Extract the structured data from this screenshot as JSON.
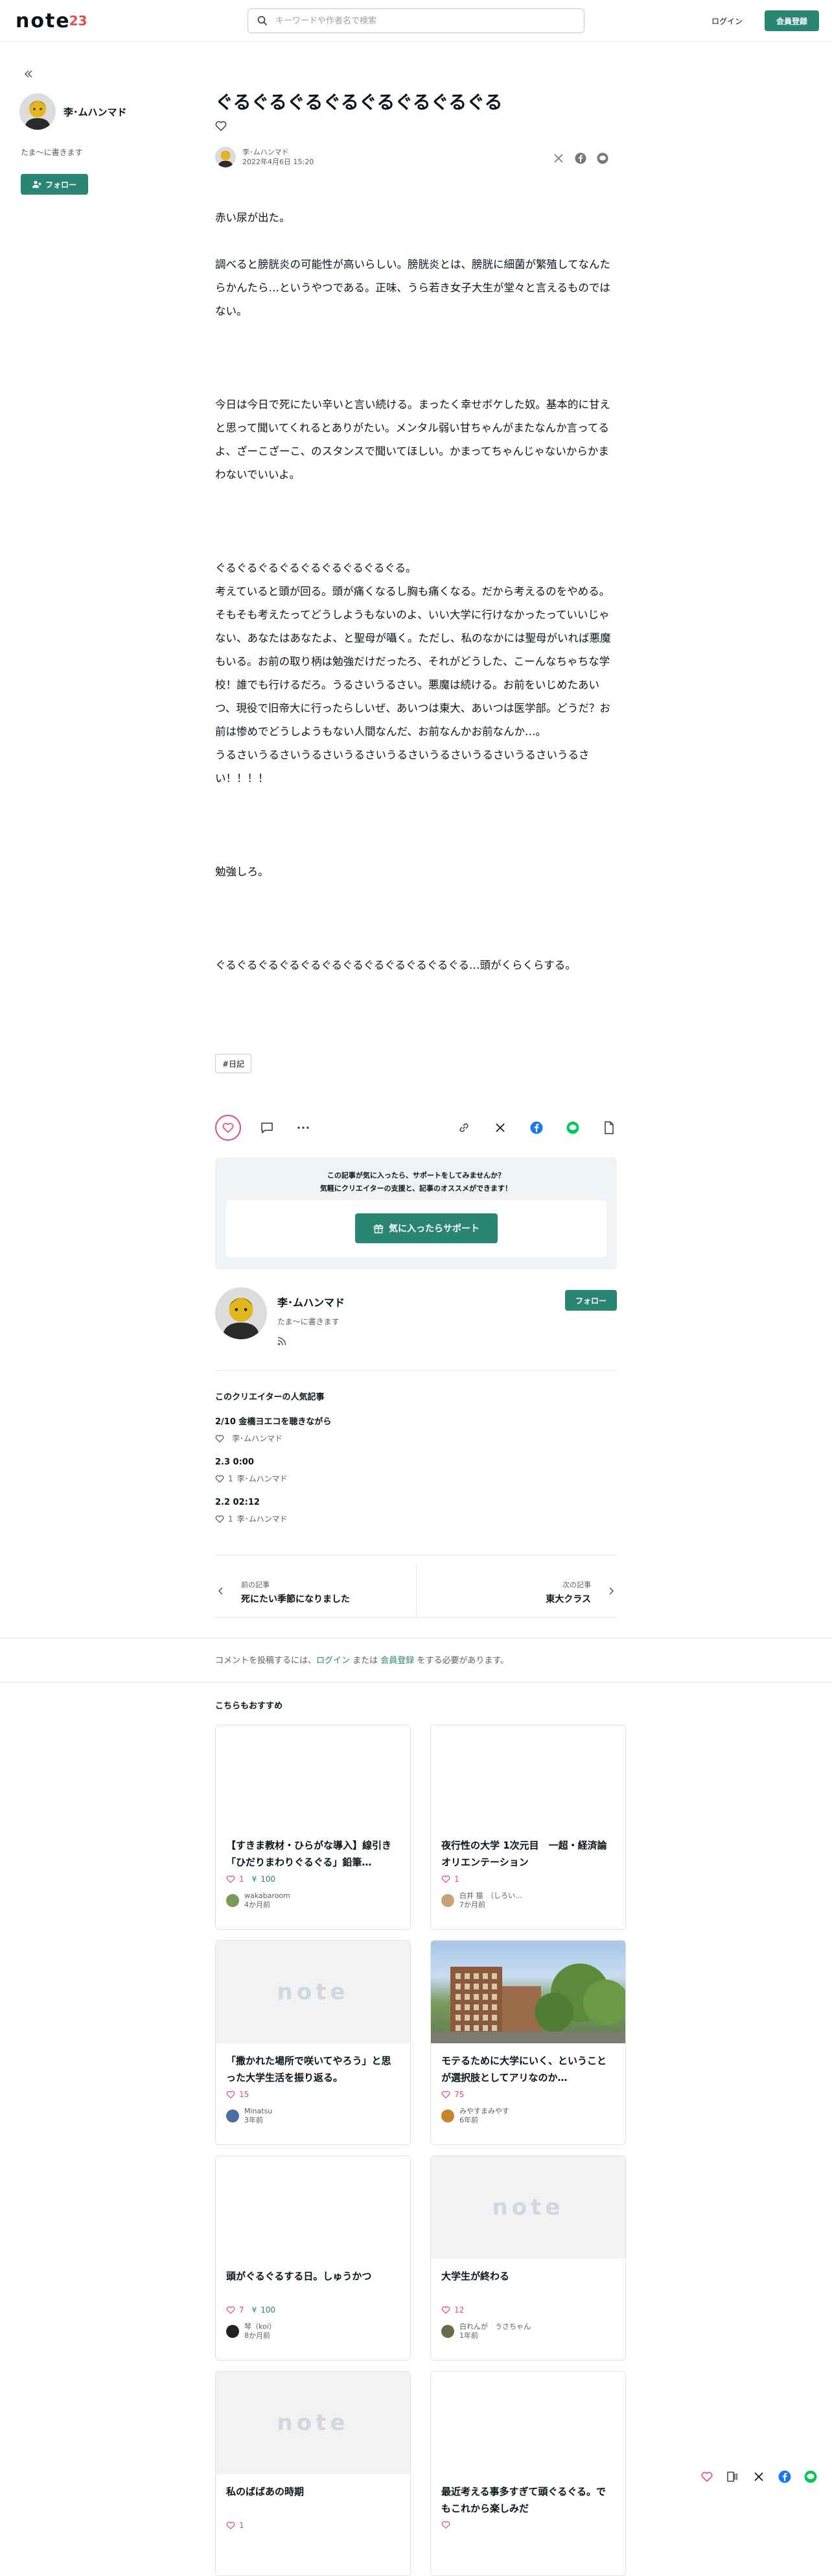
{
  "header": {
    "logo_text": "note",
    "logo_number": "23",
    "search_placeholder": "キーワードや作者名で検索",
    "login_label": "ログイン",
    "signup_label": "会員登録"
  },
  "sidebar": {
    "author_name": "李･ムハンマド",
    "bio": "たま～に書きます",
    "follow_label": "フォロー"
  },
  "article": {
    "title": "ぐるぐるぐるぐるぐるぐるぐるぐる",
    "author_name": "李･ムハンマド",
    "date": "2022年4月6日 15:20",
    "paragraphs": [
      "赤い尿が出た。",
      "",
      "調べると膀胱炎の可能性が高いらしい。膀胱炎とは、膀胱に細菌が繁殖してなんたらかんたら…というやつである。正味、うら若き女子大生が堂々と言えるものではない。",
      "",
      "",
      "",
      "今日は今日で死にたい辛いと言い続ける。まったく幸せボケした奴。基本的に甘えと思って聞いてくれるとありがたい。メンタル弱い甘ちゃんがまたなんか言ってるよ、ざーこざーこ、のスタンスで聞いてほしい。かまってちゃんじゃないからかまわないでいいよ。",
      "",
      "",
      "",
      "ぐるぐるぐるぐるぐるぐるぐるぐるぐる。",
      "考えていると頭が回る。頭が痛くなるし胸も痛くなる。だから考えるのをやめる。そもそも考えたってどうしようもないのよ、いい大学に行けなかったっていいじゃない、あなたはあなたよ、と聖母が囁く。ただし、私のなかには聖母がいれば悪魔もいる。お前の取り柄は勉強だけだったろ、それがどうした、こーんなちゃちな学校！誰でも行けるだろ。うるさいうるさい。悪魔は続ける。お前をいじめたあいつ、現役で旧帝大に行ったらしいぜ、あいつは東大、あいつは医学部。どうだ？お前は惨めでどうしようもない人間なんだ、お前なんかお前なんか…。",
      "うるさいうるさいうるさいうるさいうるさいうるさいうるさいうるさいうるさい！！！！",
      "",
      "",
      "",
      "勉強しろ。",
      "",
      "",
      "",
      "ぐるぐるぐるぐるぐるぐるぐるぐるぐるぐるぐるぐる…頭がくらくらする。"
    ],
    "tag": "#日記"
  },
  "support": {
    "message_line1": "この記事が気に入ったら、サポートをしてみませんか？",
    "message_line2": "気軽にクリエイターの支援と、記事のオススメができます！",
    "button_label": "気に入ったらサポート"
  },
  "creator": {
    "name": "李･ムハンマド",
    "bio": "たま～に書きます",
    "follow_label": "フォロー"
  },
  "popular": {
    "heading": "このクリエイターの人気記事",
    "items": [
      {
        "title": "2/10 金橋ヨエコを聴きながら",
        "likes": "",
        "author": "李･ムハンマド"
      },
      {
        "title": "2.3 0:00",
        "likes": "1",
        "author": "李･ムハンマド"
      },
      {
        "title": "2.2 02:12",
        "likes": "1",
        "author": "李･ムハンマド"
      }
    ]
  },
  "pager": {
    "prev_label": "前の記事",
    "prev_title": "死にたい季節になりました",
    "next_label": "次の記事",
    "next_title": "東大クラス"
  },
  "comment_note": {
    "before": "コメントを投稿するには、",
    "login": "ログイン",
    "middle": " または ",
    "signup": "会員登録",
    "after": " をする必要があります。"
  },
  "recommend": {
    "heading": "こちらもおすすめ",
    "cards": [
      {
        "title": "【すきま教材・ひらがな導入】線引き「ひだりまわりぐるぐる」鉛筆…",
        "likes": "1",
        "support": "100",
        "author": "wakabaroom",
        "time": "4か月前",
        "thumb": "blank"
      },
      {
        "title": "夜行性の大学 1次元目　一超・経済論　オリエンテーション",
        "likes": "1",
        "support": "",
        "author": "白井 猫　（しろい…",
        "time": "7か月前",
        "thumb": "blank"
      },
      {
        "title": "「撒かれた場所で咲いてやろう」と思った大学生活を振り返る。",
        "likes": "15",
        "support": "",
        "author": "Minatsu",
        "time": "3年前",
        "thumb": "note"
      },
      {
        "title": "モテるために大学にいく、ということが選択肢としてアリなのか…",
        "likes": "75",
        "support": "",
        "author": "みやすまみやす",
        "time": "6年前",
        "thumb": "photo"
      },
      {
        "title": "頭がぐるぐるする日。しゅうかつ",
        "likes": "7",
        "support": "100",
        "author": "琴（koi）",
        "time": "8か月前",
        "thumb": "blank"
      },
      {
        "title": "大学生が終わる",
        "likes": "12",
        "support": "",
        "author": "白れんが　うさちゃん",
        "time": "1年前",
        "thumb": "note"
      },
      {
        "title": "私のばばあの時期",
        "likes": "1",
        "support": "",
        "author": "",
        "time": "",
        "thumb": "note"
      },
      {
        "title": "最近考える事多すぎて頭ぐるぐる。でもこれから楽しみだ",
        "likes": "",
        "support": "",
        "author": "",
        "time": "",
        "thumb": "blank"
      }
    ]
  },
  "colors": {
    "accent": "#2b8573",
    "like": "#e0497b",
    "facebook": "#1877f2",
    "line": "#06c755"
  }
}
